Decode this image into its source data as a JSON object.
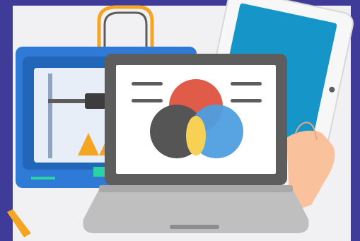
{
  "scene": {
    "background_color": "#3f3c99",
    "card_color": "#f1f1f4",
    "printer_color": "#2f7ad6",
    "printer_handle_color": "#f4a623",
    "tablet_screen_color": "#1696c8",
    "laptop_body_color": "#5d5d5d",
    "venn_colors": [
      "#e15b49",
      "#555555",
      "#4f9ee0",
      "#f7d154"
    ],
    "accent_color": "#f4a623",
    "icons": [
      "3d-printer-icon",
      "tablet-icon",
      "laptop-icon",
      "venn-diagram-icon",
      "hand-icon",
      "pencil-icon"
    ]
  }
}
